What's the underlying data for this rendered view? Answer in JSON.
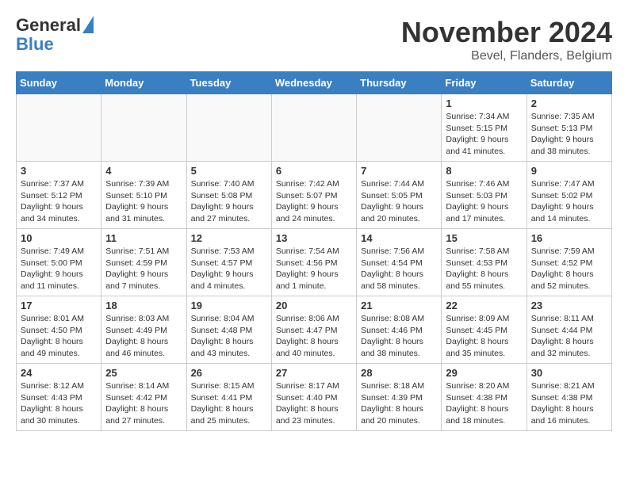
{
  "logo": {
    "general": "General",
    "blue": "Blue"
  },
  "title": "November 2024",
  "subtitle": "Bevel, Flanders, Belgium",
  "days_of_week": [
    "Sunday",
    "Monday",
    "Tuesday",
    "Wednesday",
    "Thursday",
    "Friday",
    "Saturday"
  ],
  "weeks": [
    [
      {
        "day": "",
        "info": ""
      },
      {
        "day": "",
        "info": ""
      },
      {
        "day": "",
        "info": ""
      },
      {
        "day": "",
        "info": ""
      },
      {
        "day": "",
        "info": ""
      },
      {
        "day": "1",
        "info": "Sunrise: 7:34 AM\nSunset: 5:15 PM\nDaylight: 9 hours\nand 41 minutes."
      },
      {
        "day": "2",
        "info": "Sunrise: 7:35 AM\nSunset: 5:13 PM\nDaylight: 9 hours\nand 38 minutes."
      }
    ],
    [
      {
        "day": "3",
        "info": "Sunrise: 7:37 AM\nSunset: 5:12 PM\nDaylight: 9 hours\nand 34 minutes."
      },
      {
        "day": "4",
        "info": "Sunrise: 7:39 AM\nSunset: 5:10 PM\nDaylight: 9 hours\nand 31 minutes."
      },
      {
        "day": "5",
        "info": "Sunrise: 7:40 AM\nSunset: 5:08 PM\nDaylight: 9 hours\nand 27 minutes."
      },
      {
        "day": "6",
        "info": "Sunrise: 7:42 AM\nSunset: 5:07 PM\nDaylight: 9 hours\nand 24 minutes."
      },
      {
        "day": "7",
        "info": "Sunrise: 7:44 AM\nSunset: 5:05 PM\nDaylight: 9 hours\nand 20 minutes."
      },
      {
        "day": "8",
        "info": "Sunrise: 7:46 AM\nSunset: 5:03 PM\nDaylight: 9 hours\nand 17 minutes."
      },
      {
        "day": "9",
        "info": "Sunrise: 7:47 AM\nSunset: 5:02 PM\nDaylight: 9 hours\nand 14 minutes."
      }
    ],
    [
      {
        "day": "10",
        "info": "Sunrise: 7:49 AM\nSunset: 5:00 PM\nDaylight: 9 hours\nand 11 minutes."
      },
      {
        "day": "11",
        "info": "Sunrise: 7:51 AM\nSunset: 4:59 PM\nDaylight: 9 hours\nand 7 minutes."
      },
      {
        "day": "12",
        "info": "Sunrise: 7:53 AM\nSunset: 4:57 PM\nDaylight: 9 hours\nand 4 minutes."
      },
      {
        "day": "13",
        "info": "Sunrise: 7:54 AM\nSunset: 4:56 PM\nDaylight: 9 hours\nand 1 minute."
      },
      {
        "day": "14",
        "info": "Sunrise: 7:56 AM\nSunset: 4:54 PM\nDaylight: 8 hours\nand 58 minutes."
      },
      {
        "day": "15",
        "info": "Sunrise: 7:58 AM\nSunset: 4:53 PM\nDaylight: 8 hours\nand 55 minutes."
      },
      {
        "day": "16",
        "info": "Sunrise: 7:59 AM\nSunset: 4:52 PM\nDaylight: 8 hours\nand 52 minutes."
      }
    ],
    [
      {
        "day": "17",
        "info": "Sunrise: 8:01 AM\nSunset: 4:50 PM\nDaylight: 8 hours\nand 49 minutes."
      },
      {
        "day": "18",
        "info": "Sunrise: 8:03 AM\nSunset: 4:49 PM\nDaylight: 8 hours\nand 46 minutes."
      },
      {
        "day": "19",
        "info": "Sunrise: 8:04 AM\nSunset: 4:48 PM\nDaylight: 8 hours\nand 43 minutes."
      },
      {
        "day": "20",
        "info": "Sunrise: 8:06 AM\nSunset: 4:47 PM\nDaylight: 8 hours\nand 40 minutes."
      },
      {
        "day": "21",
        "info": "Sunrise: 8:08 AM\nSunset: 4:46 PM\nDaylight: 8 hours\nand 38 minutes."
      },
      {
        "day": "22",
        "info": "Sunrise: 8:09 AM\nSunset: 4:45 PM\nDaylight: 8 hours\nand 35 minutes."
      },
      {
        "day": "23",
        "info": "Sunrise: 8:11 AM\nSunset: 4:44 PM\nDaylight: 8 hours\nand 32 minutes."
      }
    ],
    [
      {
        "day": "24",
        "info": "Sunrise: 8:12 AM\nSunset: 4:43 PM\nDaylight: 8 hours\nand 30 minutes."
      },
      {
        "day": "25",
        "info": "Sunrise: 8:14 AM\nSunset: 4:42 PM\nDaylight: 8 hours\nand 27 minutes."
      },
      {
        "day": "26",
        "info": "Sunrise: 8:15 AM\nSunset: 4:41 PM\nDaylight: 8 hours\nand 25 minutes."
      },
      {
        "day": "27",
        "info": "Sunrise: 8:17 AM\nSunset: 4:40 PM\nDaylight: 8 hours\nand 23 minutes."
      },
      {
        "day": "28",
        "info": "Sunrise: 8:18 AM\nSunset: 4:39 PM\nDaylight: 8 hours\nand 20 minutes."
      },
      {
        "day": "29",
        "info": "Sunrise: 8:20 AM\nSunset: 4:38 PM\nDaylight: 8 hours\nand 18 minutes."
      },
      {
        "day": "30",
        "info": "Sunrise: 8:21 AM\nSunset: 4:38 PM\nDaylight: 8 hours\nand 16 minutes."
      }
    ]
  ]
}
